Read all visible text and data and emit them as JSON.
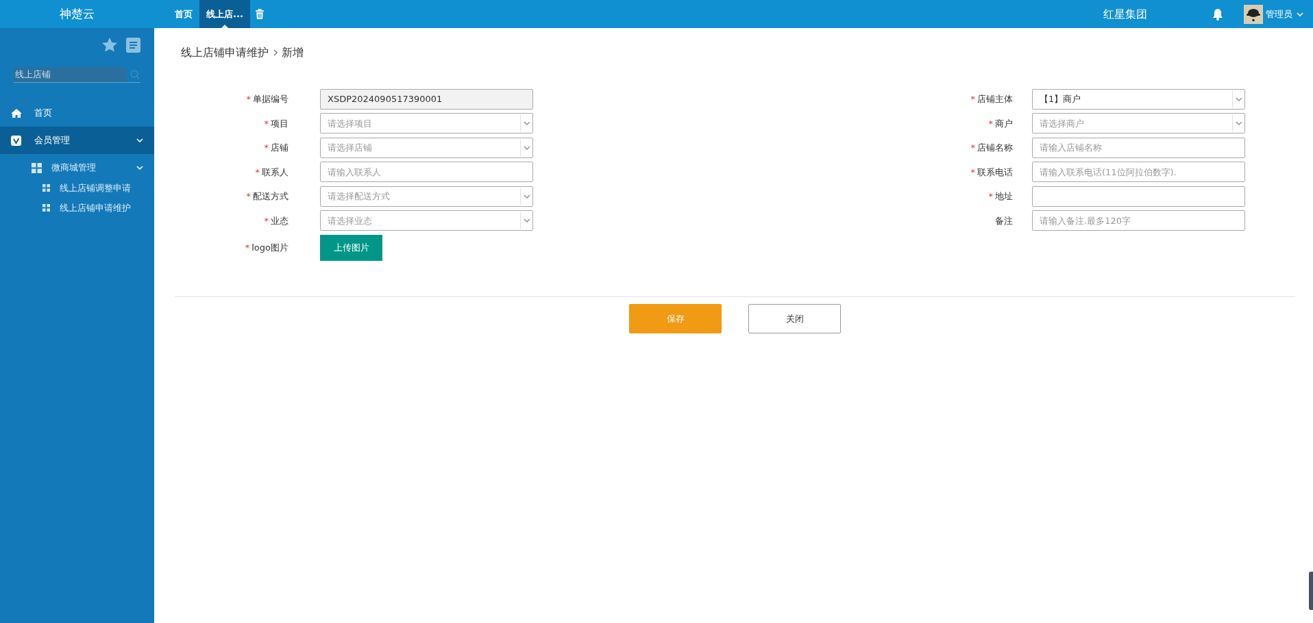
{
  "app_title": "神楚云",
  "tabs": [
    {
      "label": "首页",
      "selected": false
    },
    {
      "label": "线上店...",
      "selected": true
    }
  ],
  "company": "红星集团",
  "user": {
    "name": "管理员"
  },
  "sidebar": {
    "search": {
      "value": "线上店铺"
    },
    "items": [
      {
        "label": "首页",
        "selected": false
      },
      {
        "label": "会员管理",
        "selected": true,
        "expanded": true,
        "children": [
          {
            "label": "微商城管理",
            "expanded": true,
            "children": [
              {
                "label": "线上店铺调整申请"
              },
              {
                "label": "线上店铺申请维护"
              }
            ]
          }
        ]
      }
    ]
  },
  "breadcrumb": [
    "线上店铺申请维护",
    "新增"
  ],
  "form": {
    "left": [
      {
        "label": "单据编号",
        "required_mark": "*",
        "kind": "readonly",
        "value": "XSDP2024090517390001"
      },
      {
        "label": "项目",
        "required_mark": "*",
        "kind": "select",
        "placeholder": "请选择项目"
      },
      {
        "label": "店铺",
        "required_mark": "*",
        "kind": "select",
        "placeholder": "请选择店铺"
      },
      {
        "label": "联系人",
        "required_mark": "*",
        "kind": "input",
        "placeholder": "请输入联系人"
      },
      {
        "label": "配送方式",
        "required_mark": "*",
        "kind": "select",
        "placeholder": "请选择配送方式"
      },
      {
        "label": "业态",
        "required_mark": "*",
        "kind": "select",
        "placeholder": "请选择业态"
      },
      {
        "label": "logo图片",
        "required_mark": "*",
        "kind": "upload",
        "button": "上传图片"
      }
    ],
    "right": [
      {
        "label": "店铺主体",
        "required_mark": "*",
        "kind": "select",
        "value": "【1】商户"
      },
      {
        "label": "商户",
        "required_mark": "*",
        "kind": "select",
        "placeholder": "请选择商户"
      },
      {
        "label": "店铺名称",
        "required_mark": "*",
        "kind": "input",
        "placeholder": "请输入店铺名称"
      },
      {
        "label": "联系电话",
        "required_mark": "*",
        "kind": "input",
        "placeholder": "请输入联系电话(11位阿拉伯数字)."
      },
      {
        "label": "地址",
        "required_mark": "*",
        "kind": "input"
      },
      {
        "label": "备注",
        "kind": "input",
        "placeholder": "请输入备注.最多120字"
      }
    ]
  },
  "buttons": [
    {
      "label": "保存",
      "kind": "primary"
    },
    {
      "label": "关闭",
      "kind": "secondary"
    }
  ]
}
